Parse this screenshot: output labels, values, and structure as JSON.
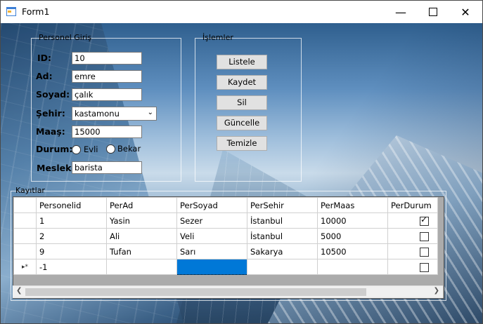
{
  "window": {
    "title": "Form1",
    "minimize_icon": "minimize-icon",
    "maximize_icon": "maximize-icon",
    "close_icon": "close-icon"
  },
  "personel": {
    "group_label": "Personel Giriş",
    "fields": {
      "id": {
        "label": "ID:",
        "value": "10"
      },
      "ad": {
        "label": "Ad:",
        "value": "emre"
      },
      "soyad": {
        "label": "Soyad:",
        "value": "çalık"
      },
      "sehir": {
        "label": "Şehir:",
        "value": "kastamonu"
      },
      "maas": {
        "label": "Maaş:",
        "value": "15000"
      },
      "durum": {
        "label": "Durum:",
        "options": [
          "Evli",
          "Bekar"
        ]
      },
      "meslek": {
        "label": "Meslek:",
        "value": "barista"
      }
    }
  },
  "islemler": {
    "group_label": "İşlemler",
    "buttons": [
      "Listele",
      "Kaydet",
      "Sil",
      "Güncelle",
      "Temizle"
    ]
  },
  "kayitlar": {
    "group_label": "Kayıtlar",
    "columns": [
      "Personelid",
      "PerAd",
      "PerSoyad",
      "PerSehir",
      "PerMaas",
      "PerDurum"
    ],
    "rows": [
      {
        "id": "1",
        "ad": "Yasin",
        "soyad": "Sezer",
        "sehir": "İstanbul",
        "maas": "10000",
        "durum": true
      },
      {
        "id": "2",
        "ad": "Ali",
        "soyad": "Veli",
        "sehir": "İstanbul",
        "maas": "5000",
        "durum": false
      },
      {
        "id": "9",
        "ad": "Tufan",
        "soyad": "Sarı",
        "sehir": "Sakarya",
        "maas": "10500",
        "durum": false
      }
    ],
    "new_row": {
      "marker": "▸*",
      "id": "-1"
    }
  }
}
